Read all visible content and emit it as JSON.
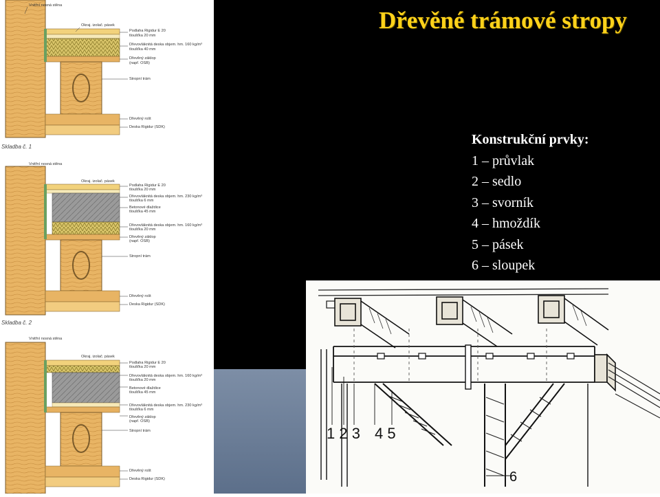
{
  "slide": {
    "title": "Dřevěné trámové stropy",
    "list_heading": "Konstrukční prvky:",
    "list_items": [
      "1 – průvlak",
      "2 – sedlo",
      "3 – svorník",
      "4 – hmoždík",
      "5 – pásek",
      "6 – sloupek"
    ]
  },
  "left_panel": {
    "sections": [
      {
        "caption": "Skladba č. 1",
        "labels": [
          "Vnitřní nosná stěna",
          "Okraj. izolač. pásek",
          "Podlaha Rigidur E 20",
          "tloušťka 20 mm",
          "Dřevovláknitá deska objem. hm. 160 kg/m³",
          "tloušťka 40 mm",
          "Dřevěný záklop",
          "(např. OSB)",
          "Stropní trám",
          "Dřevěný rošt",
          "Deska Rigidur (SDK)"
        ]
      },
      {
        "caption": "Skladba č. 2",
        "labels": [
          "Vnitřní nosná stěna",
          "Okraj. izolač. pásek",
          "Podlaha Rigidur E 20",
          "tloušťka 20 mm",
          "Dřevovláknitá deska objem. hm. 230 kg/m³",
          "tloušťka 6 mm",
          "Betonové dlaždice",
          "tloušťka 45 mm",
          "Dřevovláknitá deska objem. hm. 160 kg/m³",
          "tloušťka 20 mm",
          "Dřevěný záklop",
          "(např. OSB)",
          "Stropní trám",
          "Dřevěný rošt",
          "Deska Rigidur (SDK)"
        ]
      },
      {
        "caption": "",
        "labels": [
          "Vnitřní nosná stěna",
          "Okraj. izolač. pásek",
          "Podlaha Rigidur E 20",
          "tloušťka 20 mm",
          "Dřevovláknitá deska objem. hm. 160 kg/m³",
          "tloušťka 20 mm",
          "Betonové dlaždice",
          "tloušťka 45 mm",
          "Dřevovláknitá deska objem. hm. 230 kg/m³",
          "tloušťka 6 mm",
          "Dřevěný záklop",
          "(např. OSB)",
          "Stropní trám",
          "Dřevěný rošt",
          "Deska Rigidur (SDK)"
        ]
      }
    ]
  },
  "sketch": {
    "numbers_left": "1 2 3",
    "numbers_mid": "4 5",
    "number_bottom": "6"
  }
}
